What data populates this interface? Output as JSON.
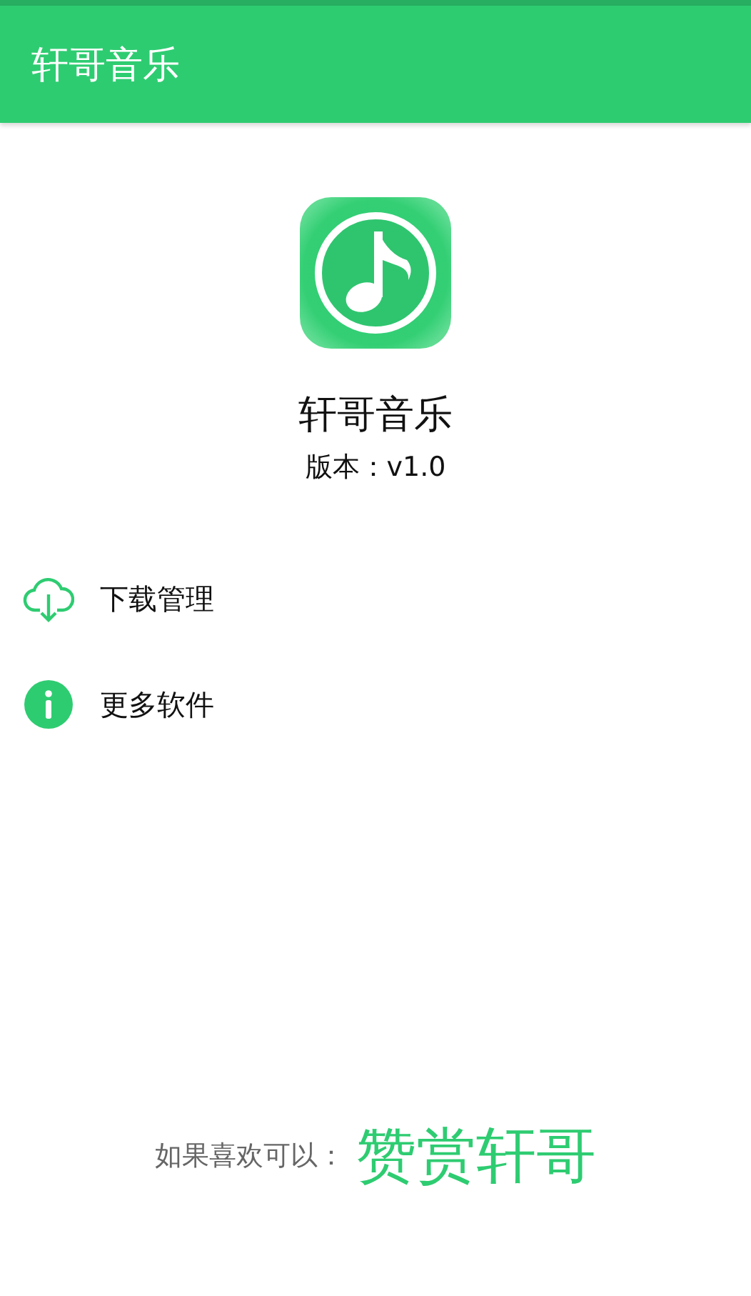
{
  "app_bar": {
    "title": "轩哥音乐"
  },
  "about": {
    "name": "轩哥音乐",
    "version": "版本：v1.0"
  },
  "menu": [
    {
      "kind": "download",
      "label": "下载管理"
    },
    {
      "kind": "info",
      "label": "更多软件"
    }
  ],
  "footer": {
    "prompt": "如果喜欢可以：",
    "action": "赞赏轩哥"
  }
}
